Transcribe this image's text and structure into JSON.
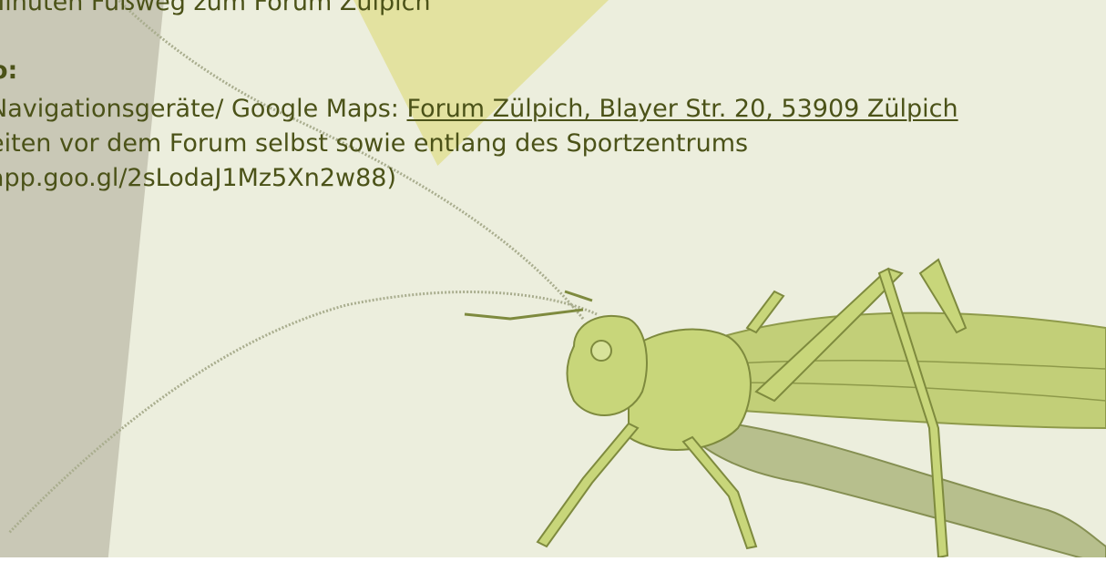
{
  "content": {
    "line_walk": "Minuten Fußweg zum Forum Zülpich",
    "heading_car": "o:",
    "line_nav_prefix": " Navigationsgeräte/ Google Maps: ",
    "nav_link": "Forum Zülpich, Blayer Str. 20, 53909 Zülpich",
    "line_parking": "eiten vor dem Forum selbst sowie entlang des Sportzentrums",
    "line_maplink": "app.goo.gl/2sLodaJ1Mz5Xn2w88)"
  },
  "colors": {
    "background": "#eceedd",
    "text": "#4b5218",
    "accent_yellow": "#e3e2a0",
    "grey_band": "#c9c8b6",
    "insect": "#c8d67a"
  },
  "illustration": {
    "name": "grasshopper-illustration"
  }
}
